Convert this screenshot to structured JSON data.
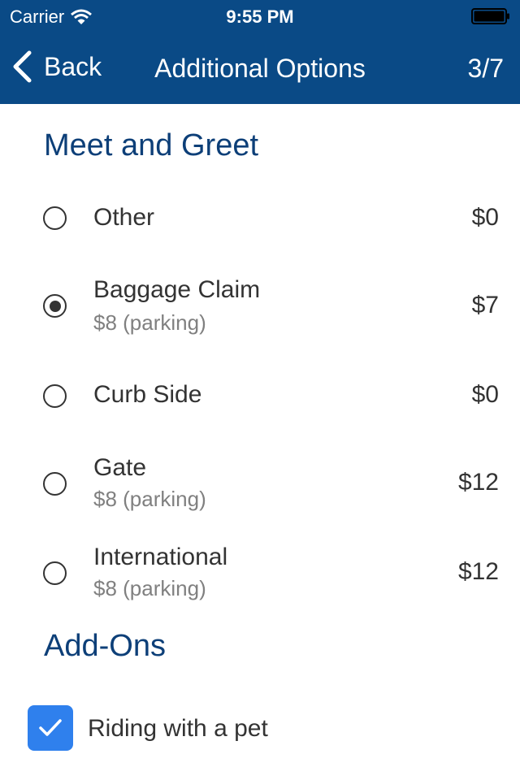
{
  "status_bar": {
    "carrier": "Carrier",
    "time": "9:55 PM"
  },
  "nav": {
    "back_label": "Back",
    "title": "Additional Options",
    "step": "3/7"
  },
  "meet_and_greet": {
    "title": "Meet and Greet",
    "options": [
      {
        "label": "Other",
        "sublabel": "",
        "price": "$0",
        "selected": false
      },
      {
        "label": "Baggage Claim",
        "sublabel": "$8 (parking)",
        "price": "$7",
        "selected": true
      },
      {
        "label": "Curb Side",
        "sublabel": "",
        "price": "$0",
        "selected": false
      },
      {
        "label": "Gate",
        "sublabel": "$8 (parking)",
        "price": "$12",
        "selected": false
      },
      {
        "label": "International",
        "sublabel": "$8 (parking)",
        "price": "$12",
        "selected": false
      }
    ]
  },
  "add_ons": {
    "title": "Add-Ons",
    "items": [
      {
        "label": "Riding with a pet",
        "checked": true
      }
    ]
  },
  "colors": {
    "header": "#0a4a86",
    "section_title": "#0d3f78",
    "checkbox": "#2f80ed"
  }
}
